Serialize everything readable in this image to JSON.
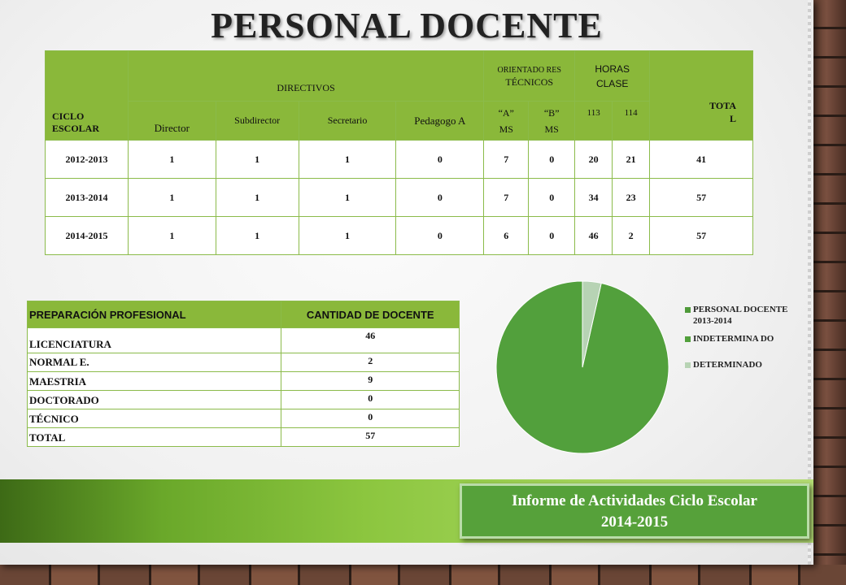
{
  "title": "PERSONAL DOCENTE",
  "staff_table": {
    "h_ciclo": "CICLO ESCOLAR",
    "h_directivos": "DIRECTIVOS",
    "h_orientadores": "ORIENTADO RES",
    "h_tecnicos": "TÉCNICOS",
    "h_horas": "HORAS CLASE",
    "h_total": "TOTA L",
    "sub": {
      "director": "Director",
      "subdirector": "Subdirector",
      "secretario": "Secretario",
      "pedagogo": "Pedagogo A",
      "a_ms": "“A” MS",
      "b_ms": "“B” MS",
      "h113": "113",
      "h114": "114"
    },
    "rows": [
      {
        "ciclo": "2012-2013",
        "director": "1",
        "subdirector": "1",
        "secretario": "1",
        "pedagogo": "0",
        "a": "7",
        "b": "0",
        "h113": "20",
        "h114": "21",
        "total": "41"
      },
      {
        "ciclo": "2013-2014",
        "director": "1",
        "subdirector": "1",
        "secretario": "1",
        "pedagogo": "0",
        "a": "7",
        "b": "0",
        "h113": "34",
        "h114": "23",
        "total": "57"
      },
      {
        "ciclo": "2014-2015",
        "director": "1",
        "subdirector": "1",
        "secretario": "1",
        "pedagogo": "0",
        "a": "6",
        "b": "0",
        "h113": "46",
        "h114": "2",
        "total": "57"
      }
    ]
  },
  "prep_table": {
    "h_prep": "PREPARACIÓN PROFESIONAL",
    "h_cant": "CANTIDAD DE DOCENTE",
    "rows": [
      {
        "label": "LICENCIATURA",
        "value": "46"
      },
      {
        "label": "NORMAL E.",
        "value": "2"
      },
      {
        "label": "MAESTRIA",
        "value": "9"
      },
      {
        "label": "DOCTORADO",
        "value": "0"
      },
      {
        "label": "TÉCNICO",
        "value": "0"
      },
      {
        "label": "TOTAL",
        "value": "57"
      }
    ]
  },
  "chart_data": {
    "type": "pie",
    "labels": [
      "PERSONAL DOCENTE 2013-2014",
      "INDETERMINADO",
      "DETERMINADO"
    ],
    "legend_labels": [
      "PERSONAL DOCENTE 2013-2014",
      "INDETERMINA DO",
      "DETERMINADO"
    ],
    "values": [
      0,
      55,
      2
    ],
    "colors": [
      "#4f9a3a",
      "#52a03c",
      "#b7d3b4"
    ],
    "legend": "right"
  },
  "banner": {
    "line1": "Informe de Actividades Ciclo Escolar",
    "line2": "2014-2015"
  }
}
